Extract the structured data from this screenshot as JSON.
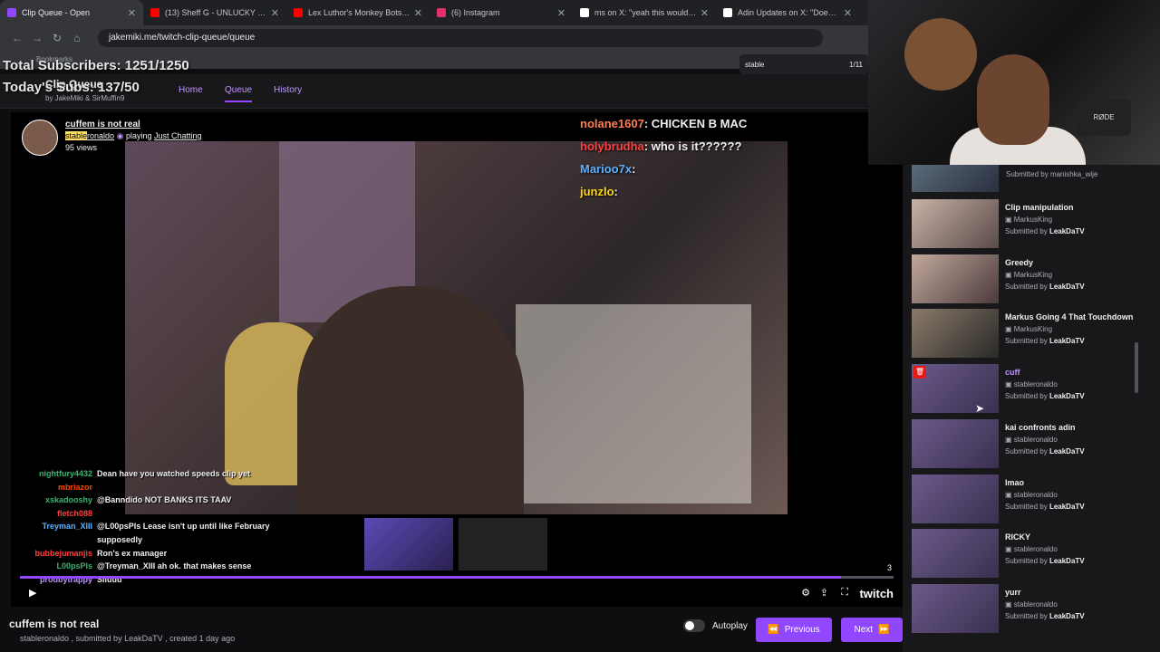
{
  "browser": {
    "tabs": [
      {
        "title": "Clip Queue - Open",
        "color": "#9147ff"
      },
      {
        "title": "(13) Sheff G - UNLUCKY LUCKY",
        "color": "#ff0000"
      },
      {
        "title": "Lex Luthor's Monkey Bots | SUP",
        "color": "#ff0000"
      },
      {
        "title": "(6) Instagram",
        "color": "#e1306c"
      },
      {
        "title": "ms on X: \"yeah this would be m",
        "color": "#ffffff"
      },
      {
        "title": "Adin Updates on X: \"Doechii se",
        "color": "#ffffff"
      }
    ],
    "url": "jakemiki.me/twitch-clip-queue/queue",
    "bookmarks_label": "Bookmarks",
    "find_query": "stable",
    "find_count": "1/11"
  },
  "overlay": {
    "total_subs": "Total Subscribers: 1251/1250",
    "today_subs": "Today's Subs: 137/50"
  },
  "app": {
    "logo": "Clip Queue",
    "by": "by JakeMiki & SirMuffin9",
    "nav": [
      "Home",
      "Queue",
      "History"
    ]
  },
  "clip": {
    "title": "cuffem is not real",
    "channel_hl": "stable",
    "channel_rest": "ronaldo",
    "playing": "playing",
    "game": "Just Chatting",
    "views": "95 views",
    "submitted_by": "stableronaldo , submitted by LeakDaTV , created 1 day ago"
  },
  "chat_top": [
    {
      "user": "nolane1607",
      "msg": "CHICKEN B MAC"
    },
    {
      "user": "holybrudha",
      "msg": "who is it??????"
    },
    {
      "user": "Marioo7x",
      "msg": ""
    },
    {
      "user": "junzlo",
      "msg": ""
    }
  ],
  "chat_bottom": [
    {
      "user": "nightfury4432",
      "msg": "Dean have you watched speeds clip yet",
      "color": "#3cb371"
    },
    {
      "user": "mbriazor",
      "msg": "",
      "color": "#ff4500"
    },
    {
      "user": "xskadooshy",
      "msg": "@Banndido NOT BANKS ITS TAAV",
      "color": "#3cb371"
    },
    {
      "user": "fletch088",
      "msg": "",
      "color": "#ff4040"
    },
    {
      "user": "Treyman_XIII",
      "msg": "@L00psPls Lease isn't up until like February supposedly",
      "color": "#5fb0ff"
    },
    {
      "user": "bubbejumanjis",
      "msg": "Ron's ex manager",
      "color": "#ff4040"
    },
    {
      "user": "L00psPls",
      "msg": "@Treyman_XIII ah ok. that makes sense",
      "color": "#3cb371"
    },
    {
      "user": "prodbytrappy",
      "msg": "Sliuuu",
      "color": "#bf94ff"
    }
  ],
  "player": {
    "counter": "3",
    "progress": 0.94,
    "brand": "twitch"
  },
  "controls": {
    "autoplay": "Autoplay",
    "previous": "Previous",
    "next": "Next"
  },
  "queue": [
    {
      "title": "Clip manipulation",
      "channel": "MarkusKing",
      "submitter": "LeakDaTV",
      "thumb": "g1"
    },
    {
      "title": "Greedy",
      "channel": "MarkusKing",
      "submitter": "LeakDaTV",
      "thumb": "g2"
    },
    {
      "title": "Markus Going 4 That Touchdown",
      "channel": "MarkusKing",
      "submitter": "LeakDaTV",
      "thumb": "g3"
    },
    {
      "title": "cuff",
      "channel": "stableronaldo",
      "submitter": "LeakDaTV",
      "thumb": "",
      "current": true
    },
    {
      "title": "kai confronts adin",
      "channel": "stableronaldo",
      "submitter": "LeakDaTV",
      "thumb": ""
    },
    {
      "title": "lmao",
      "channel": "stableronaldo",
      "submitter": "LeakDaTV",
      "thumb": ""
    },
    {
      "title": "RICKY",
      "channel": "stableronaldo",
      "submitter": "LeakDaTV",
      "thumb": ""
    },
    {
      "title": "yurr",
      "channel": "stableronaldo",
      "submitter": "LeakDaTV",
      "thumb": ""
    }
  ],
  "queue_top_submitter": "manishka_wije",
  "submitted_by_label": "Submitted by",
  "cam_text": "RØDE"
}
